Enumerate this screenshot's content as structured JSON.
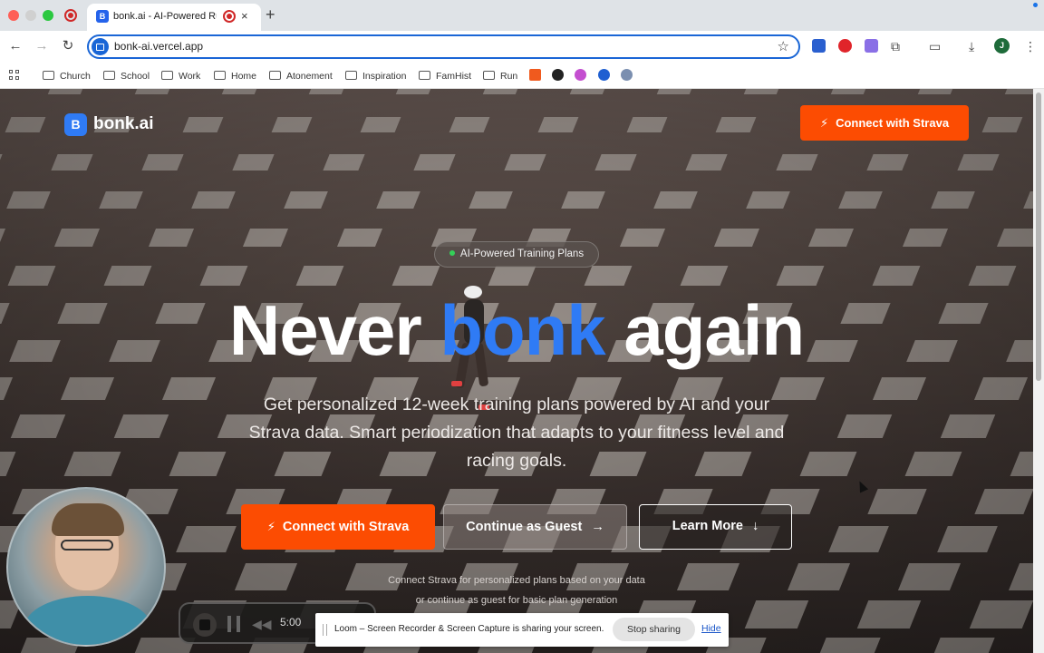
{
  "browser": {
    "tab_title": "bonk.ai - AI-Powered Run",
    "tab_favicon_letter": "B",
    "tab_close": "×",
    "new_tab": "+",
    "url": "bonk-ai.vercel.app",
    "avatar_letter": "J",
    "bookmarks": [
      "Church",
      "School",
      "Work",
      "Home",
      "Atonement",
      "Inspiration",
      "FamHist",
      "Run"
    ]
  },
  "page": {
    "logo_letter": "B",
    "logo_text": "bonk.ai",
    "header_cta": "Connect with Strava",
    "badge": "AI-Powered Training Plans",
    "headline_part1": "Never ",
    "headline_accent": "bonk",
    "headline_part2": " again",
    "subtitle": "Get personalized 12-week training plans powered by AI and your Strava data. Smart periodization that adapts to your fitness level and racing goals.",
    "primary_cta": "Connect with Strava",
    "guest_cta": "Continue as Guest",
    "guest_arrow": "→",
    "learn_cta": "Learn More",
    "learn_arrow": "↓",
    "note_line1": "Connect Strava for personalized plans based on your data",
    "note_line2": "or continue as guest for basic plan generation"
  },
  "loom": {
    "timer": "5:00",
    "share_text": "Loom – Screen Recorder & Screen Capture is sharing your screen.",
    "stop_sharing": "Stop sharing",
    "hide": "Hide"
  },
  "colors": {
    "strava_orange": "#fc4c02",
    "brand_blue": "#2f7bf5"
  }
}
